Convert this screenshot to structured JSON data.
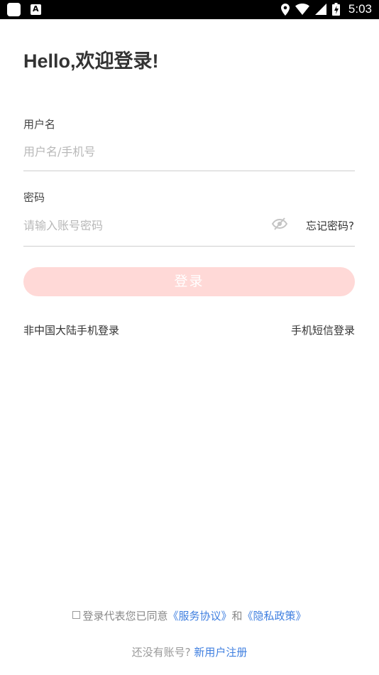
{
  "status_bar": {
    "time": "5:03"
  },
  "header": {
    "title": "Hello,欢迎登录!"
  },
  "form": {
    "username_label": "用户名",
    "username_placeholder": "用户名/手机号",
    "password_label": "密码",
    "password_placeholder": "请输入账号密码",
    "forgot_password": "忘记密码?",
    "login_button": "登录"
  },
  "alt_login": {
    "non_mainland": "非中国大陆手机登录",
    "sms_login": "手机短信登录"
  },
  "footer": {
    "agree_prefix": "登录代表您已同意",
    "service_agreement": "《服务协议》",
    "and": "和",
    "privacy_policy": "《隐私政策》",
    "no_account": "还没有账号?",
    "register": "新用户注册"
  },
  "colors": {
    "login_button_bg": "#ffd9d7",
    "link_blue": "#3f7fe0",
    "status_bar_bg": "#000000"
  }
}
